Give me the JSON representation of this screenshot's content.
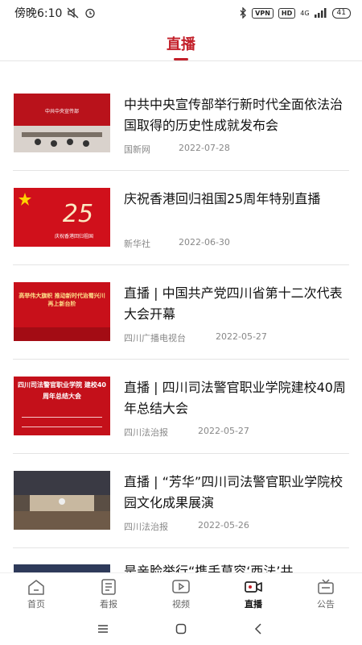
{
  "status_bar": {
    "time": "傍晚6:10",
    "vpn": "VPN",
    "hd": "HD",
    "network": "4G",
    "battery": "41"
  },
  "header": {
    "title": "直播"
  },
  "items": [
    {
      "title": "中共中央宣传部举行新时代全面依法治国取得的历史性成就发布会",
      "source": "国新网",
      "date": "2022-07-28",
      "thumb_text": "中共中央宣传部"
    },
    {
      "title": "庆祝香港回归祖国25周年特别直播",
      "source": "新华社",
      "date": "2022-06-30",
      "thumb_text": "庆祝香港回归祖国"
    },
    {
      "title": "直播 | 中国共产党四川省第十二次代表大会开幕",
      "source": "四川广播电视台",
      "date": "2022-05-27",
      "thumb_text": "高举伟大旗帜 推动新时代治蜀兴川再上新台阶"
    },
    {
      "title": "直播 | 四川司法警官职业学院建校40周年总结大会",
      "source": "四川法治报",
      "date": "2022-05-27",
      "thumb_text": "四川司法警官职业学院 建校40周年总结大会"
    },
    {
      "title": "直播 | “芳华”四川司法警官职业学院校园文化成果展演",
      "source": "四川法治报",
      "date": "2022-05-26",
      "thumb_text": ""
    },
    {
      "title": "是亲脸举行“携手莫容‘西法’共",
      "source": "",
      "date": "",
      "thumb_text": ""
    }
  ],
  "tabs": [
    {
      "label": "首页",
      "icon": "home-icon"
    },
    {
      "label": "看报",
      "icon": "newspaper-icon"
    },
    {
      "label": "视频",
      "icon": "video-icon"
    },
    {
      "label": "直播",
      "icon": "live-camera-icon",
      "active": true
    },
    {
      "label": "公告",
      "icon": "notice-icon"
    }
  ],
  "colors": {
    "accent": "#c3202a",
    "text": "#111111",
    "meta": "#888888"
  }
}
